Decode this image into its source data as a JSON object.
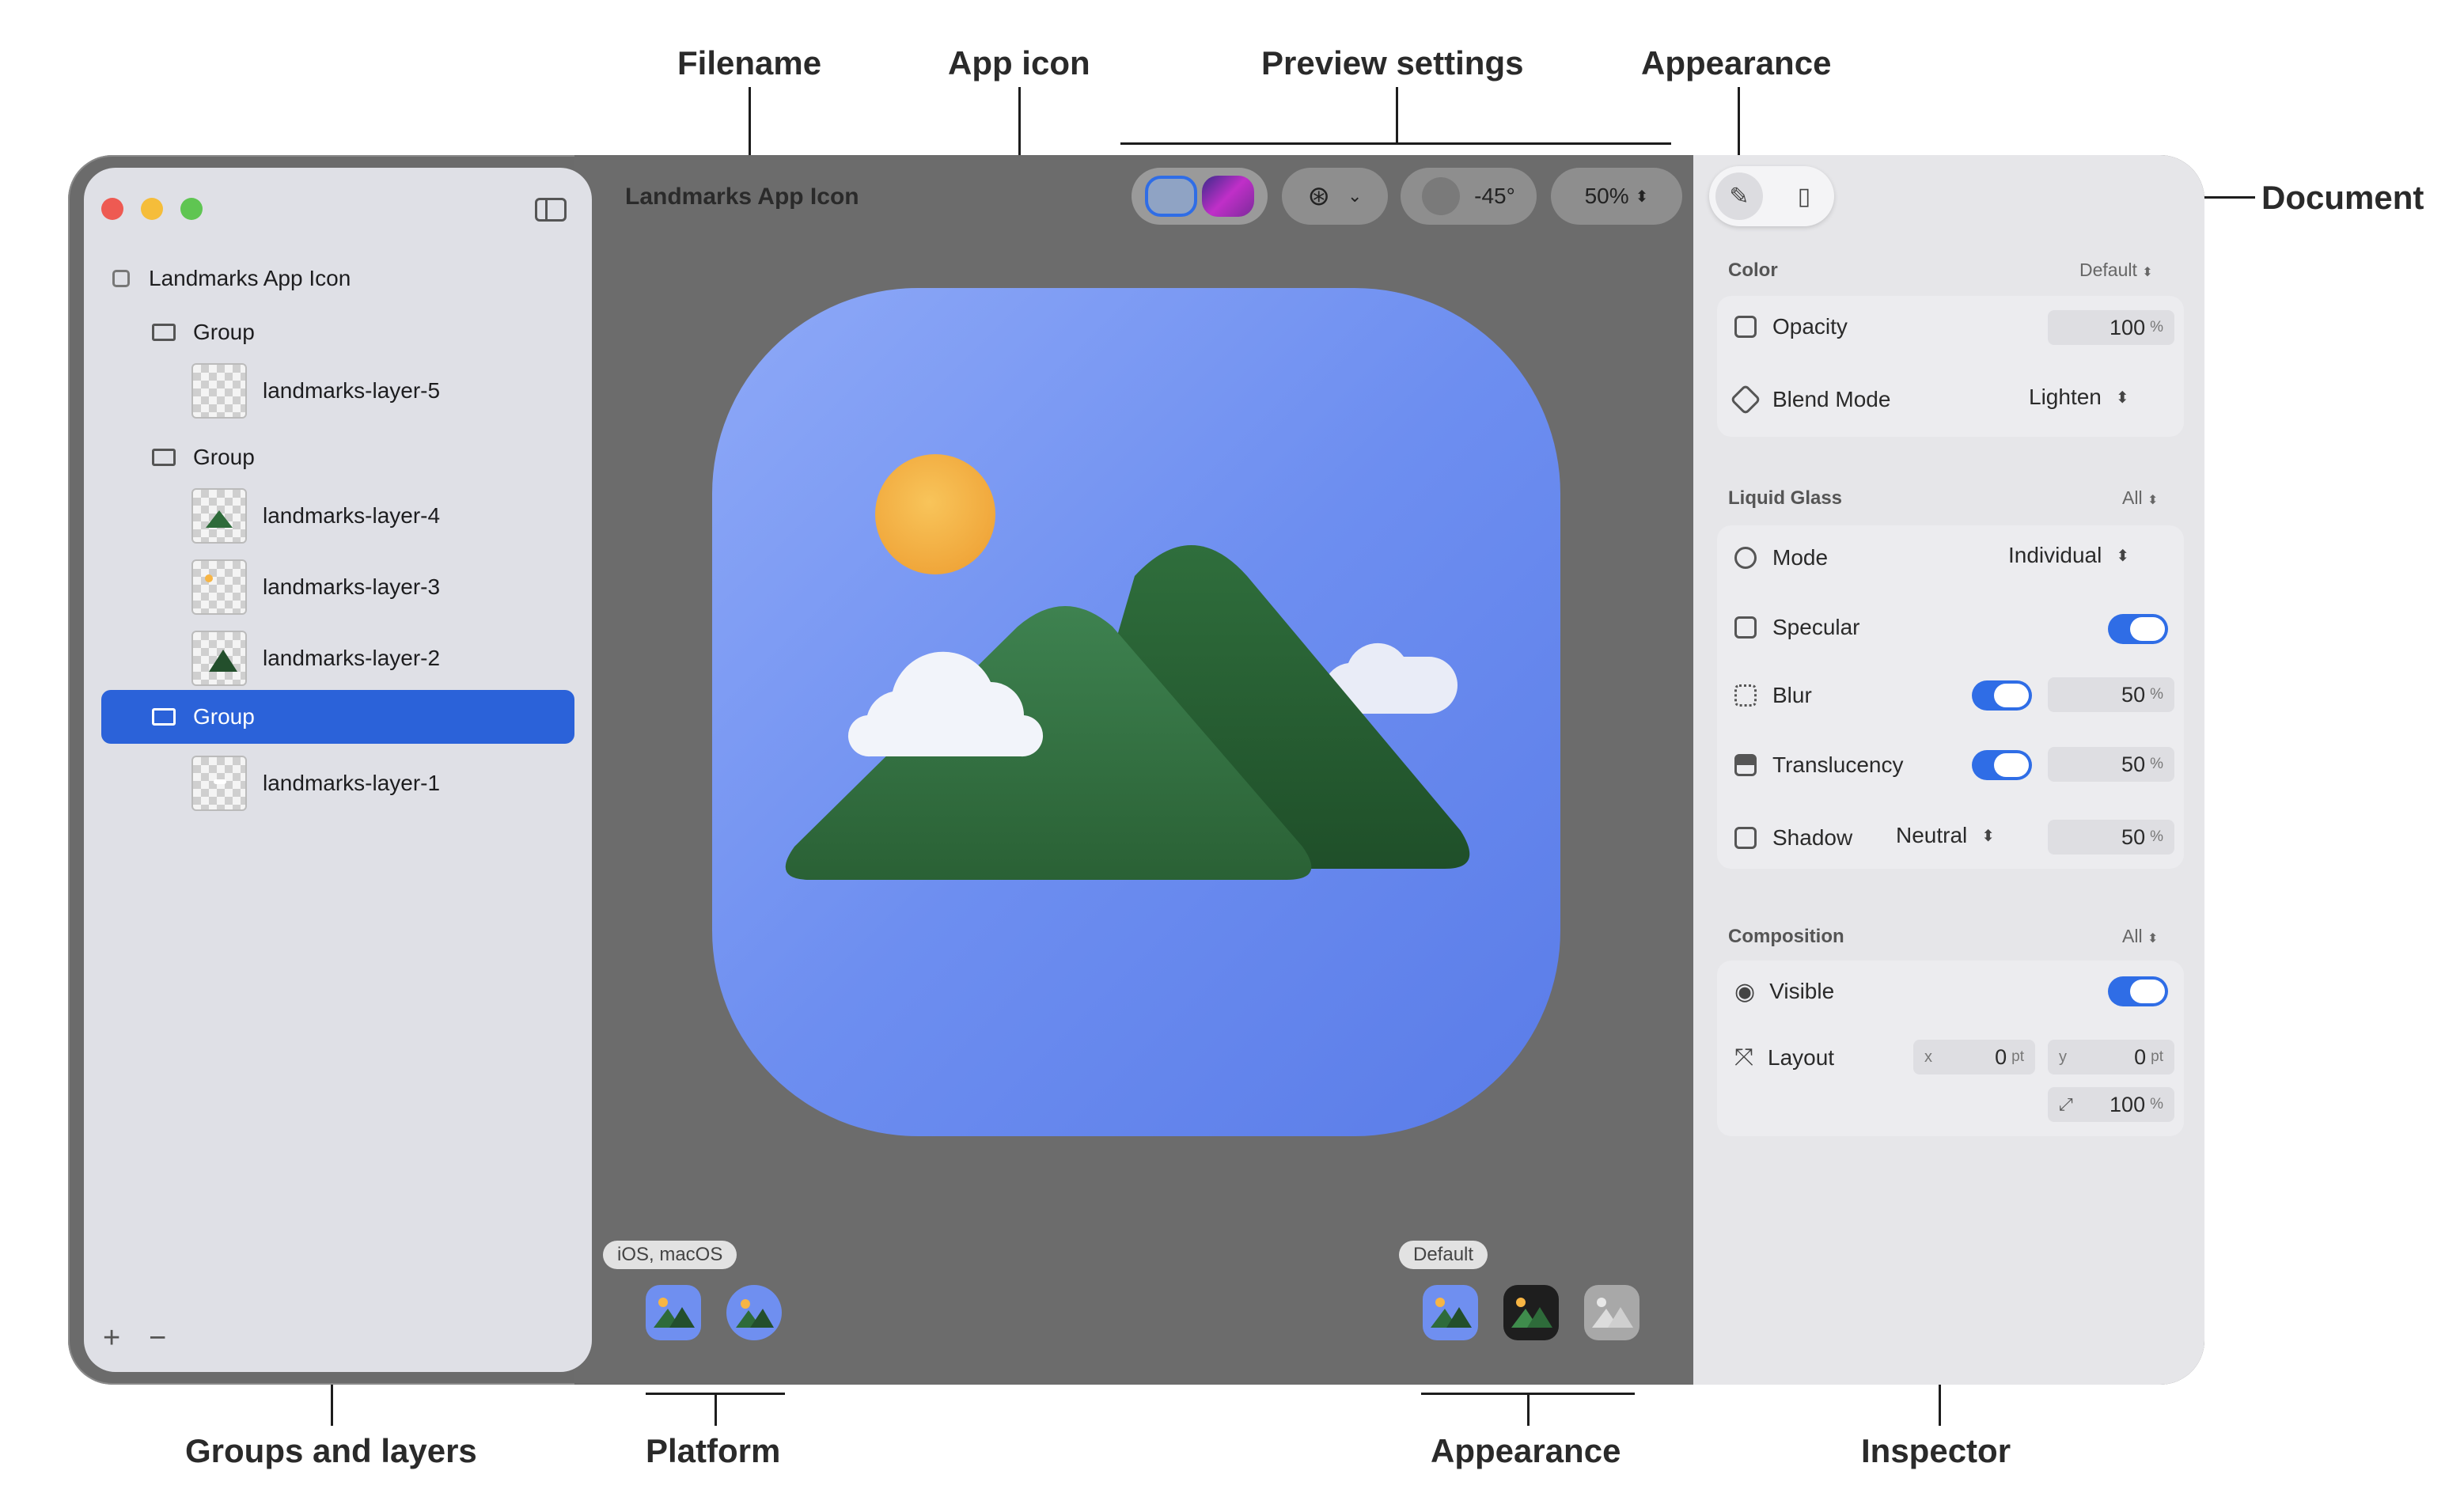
{
  "callouts": {
    "filename": "Filename",
    "app_icon": "App icon",
    "preview_settings": "Preview settings",
    "appearance_top": "Appearance",
    "document": "Document",
    "groups_and_layers": "Groups and layers",
    "platform": "Platform",
    "appearance_bottom": "Appearance",
    "inspector": "Inspector"
  },
  "window": {
    "title": "Landmarks App Icon"
  },
  "toolbar": {
    "angle": "-45°",
    "zoom": "50%"
  },
  "sidebar": {
    "root": "Landmarks App Icon",
    "items": [
      {
        "type": "group",
        "label": "Group"
      },
      {
        "type": "layer",
        "label": "landmarks-layer-5"
      },
      {
        "type": "group",
        "label": "Group"
      },
      {
        "type": "layer",
        "label": "landmarks-layer-4"
      },
      {
        "type": "layer",
        "label": "landmarks-layer-3"
      },
      {
        "type": "layer",
        "label": "landmarks-layer-2"
      },
      {
        "type": "group",
        "label": "Group",
        "selected": true
      },
      {
        "type": "layer",
        "label": "landmarks-layer-1"
      }
    ],
    "add": "+",
    "remove": "−"
  },
  "canvas": {
    "platform_tag": "iOS, macOS",
    "appearance_tag": "Default"
  },
  "inspector": {
    "color": {
      "section": "Color",
      "section_value": "Default",
      "opacity_label": "Opacity",
      "opacity_value": "100",
      "blend_label": "Blend Mode",
      "blend_value": "Lighten"
    },
    "liquid_glass": {
      "section": "Liquid Glass",
      "section_value": "All",
      "mode_label": "Mode",
      "mode_value": "Individual",
      "specular_label": "Specular",
      "blur_label": "Blur",
      "blur_value": "50",
      "translucency_label": "Translucency",
      "translucency_value": "50",
      "shadow_label": "Shadow",
      "shadow_mode": "Neutral",
      "shadow_value": "50"
    },
    "composition": {
      "section": "Composition",
      "section_value": "All",
      "visible_label": "Visible",
      "layout_label": "Layout",
      "x_label": "x",
      "x_value": "0",
      "y_label": "y",
      "y_value": "0",
      "scale_value": "100"
    },
    "units": {
      "percent": "%",
      "pt": "pt"
    }
  },
  "colors": {
    "accent": "#2f6de6",
    "selection": "#2b62d9",
    "icon_bg": "#6f8ff0",
    "mountain": "#2e6b3a",
    "sun": "#f7b544"
  }
}
